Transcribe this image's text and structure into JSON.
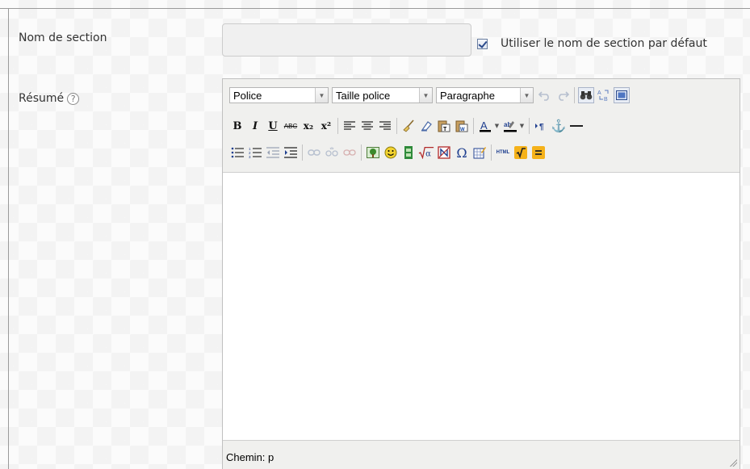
{
  "form": {
    "section_name_label": "Nom de section",
    "section_name_value": "",
    "use_default_label": "Utiliser le nom de section par défaut",
    "use_default_checked": true,
    "summary_label": "Résumé",
    "help_glyph": "?"
  },
  "editor": {
    "font_select": "Police",
    "size_select": "Taille police",
    "format_select": "Paragraphe",
    "buttons_row2": {
      "bold": "B",
      "italic": "I",
      "underline": "U",
      "strike": "ABC",
      "subscript": "x₂",
      "superscript": "x²",
      "omega": "Ω",
      "html": "HTML",
      "anchor": "⚓"
    },
    "status_path": "Chemin: p"
  },
  "colors": {
    "accent_blue": "#2b4a8c",
    "toolbar_bg": "#f0f0ee",
    "border": "#c0c0c0"
  }
}
